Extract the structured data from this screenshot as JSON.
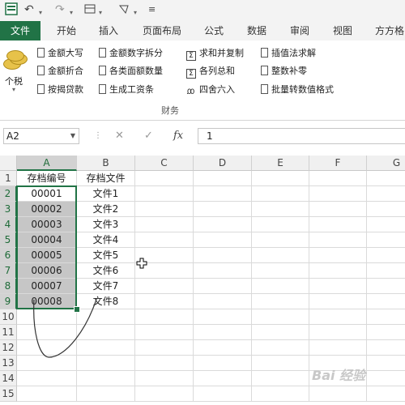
{
  "quick_access": {
    "app_icon": "excel-window-icon",
    "undo_icon": "undo-icon",
    "redo_icon": "redo-icon",
    "customize_icon": "customize-icon"
  },
  "tabs": [
    "文件",
    "开始",
    "插入",
    "页面布局",
    "公式",
    "数据",
    "审阅",
    "视图",
    "方方格"
  ],
  "ribbon": {
    "big_button": "个税",
    "commands": [
      [
        "金额大写",
        "金额数字拆分",
        "求和并复制",
        "插值法求解"
      ],
      [
        "金额折合",
        "各类面额数量",
        "各列总和",
        "整数补零"
      ],
      [
        "按揭贷款",
        "生成工资条",
        "四舍六入",
        "批量转数值格式"
      ]
    ],
    "group_label": "财务"
  },
  "formula_bar": {
    "name_box": "A2",
    "cancel": "✕",
    "enter": "✓",
    "fx": "fx",
    "value": "1"
  },
  "grid": {
    "columns": [
      "A",
      "B",
      "C",
      "D",
      "E",
      "F",
      "G"
    ],
    "rows": [
      "1",
      "2",
      "3",
      "4",
      "5",
      "6",
      "7",
      "8",
      "9",
      "10",
      "11",
      "12",
      "13",
      "14",
      "15"
    ],
    "cells": [
      [
        "存档编号",
        "存档文件"
      ],
      [
        "00001",
        "文件1"
      ],
      [
        "00002",
        "文件2"
      ],
      [
        "00003",
        "文件3"
      ],
      [
        "00004",
        "文件4"
      ],
      [
        "00005",
        "文件5"
      ],
      [
        "00006",
        "文件6"
      ],
      [
        "00007",
        "文件7"
      ],
      [
        "00008",
        "文件8"
      ]
    ],
    "selection": "A2:A9"
  },
  "watermark": "Bai 经验"
}
